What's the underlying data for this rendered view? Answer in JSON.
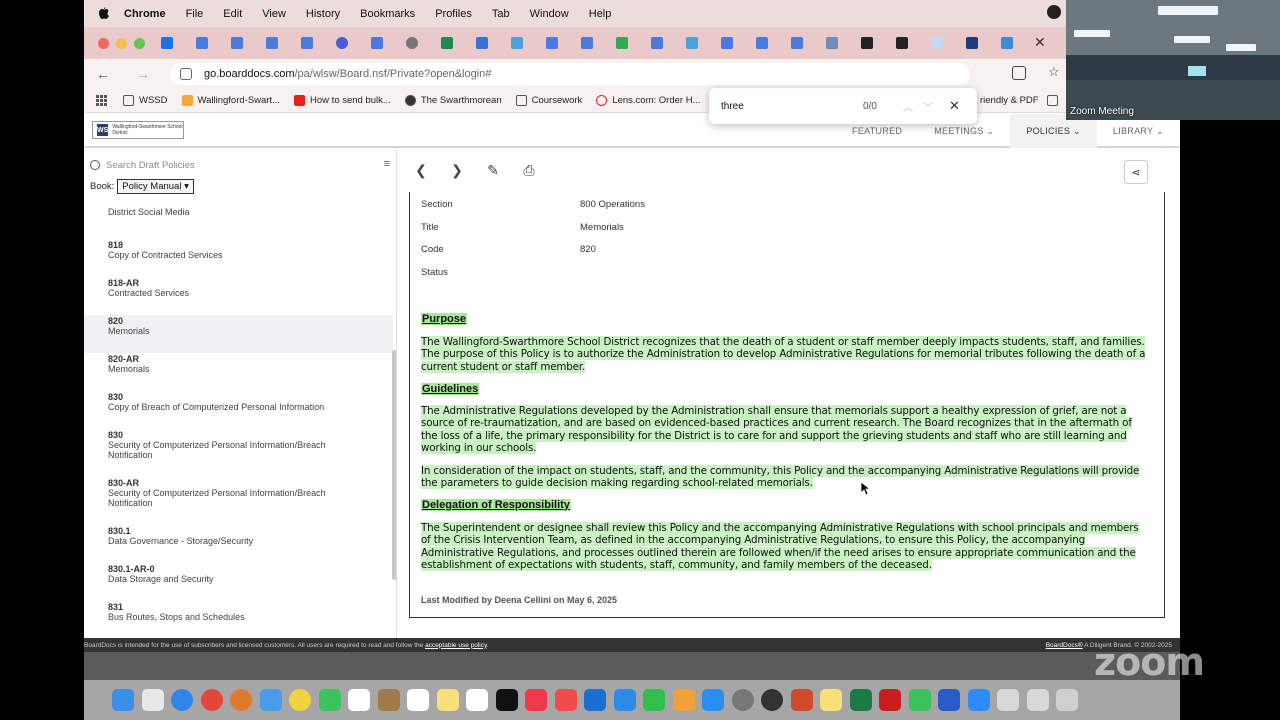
{
  "menubar": {
    "app": "Chrome",
    "items": [
      "File",
      "Edit",
      "View",
      "History",
      "Bookmarks",
      "Profiles",
      "Tab",
      "Window",
      "Help"
    ]
  },
  "address": {
    "host": "go.boarddocs.com",
    "path": "/pa/wlsw/Board.nsf/Private?open&login#"
  },
  "bookmarks": [
    "WSSD",
    "Wallingford-Swart...",
    "How to send bulk...",
    "The Swarthmorean",
    "Coursework",
    "Lens.com: Order H...",
    "riendly & PDF"
  ],
  "findbar": {
    "query": "three",
    "count": "0/0"
  },
  "boarddocs": {
    "logo_text": "Wallingford-Swarthmore School District",
    "nav": [
      "FEATURED",
      "MEETINGS",
      "POLICIES",
      "LIBRARY"
    ]
  },
  "leftpanel": {
    "search_placeholder": "Search Draft Policies",
    "book_label": "Book:",
    "book_value": "Policy Manual",
    "policies": [
      {
        "code": "",
        "title": "District Social Media"
      },
      {
        "code": "818",
        "title": "Copy of Contracted Services"
      },
      {
        "code": "818-AR",
        "title": "Contracted Services"
      },
      {
        "code": "820",
        "title": "Memorials"
      },
      {
        "code": "820-AR",
        "title": "Memorials"
      },
      {
        "code": "830",
        "title": "Copy of Breach of Computerized Personal Information"
      },
      {
        "code": "830",
        "title": "Security of Computerized Personal Information/Breach Notification"
      },
      {
        "code": "830-AR",
        "title": "Security of Computerized Personal Information/Breach Notification"
      },
      {
        "code": "830.1",
        "title": "Data Governance - Storage/Security"
      },
      {
        "code": "830.1-AR-0",
        "title": "Data Storage and Security"
      },
      {
        "code": "831",
        "title": "Bus Routes, Stops and Schedules"
      }
    ]
  },
  "doc": {
    "meta": [
      {
        "label": "Section",
        "value": "800 Operations"
      },
      {
        "label": "Title",
        "value": "Memorials"
      },
      {
        "label": "Code",
        "value": "820"
      },
      {
        "label": "Status",
        "value": ""
      }
    ],
    "purpose_head": "Purpose",
    "purpose_text": "The Wallingford-Swarthmore School District recognizes that the death of a student or staff member deeply impacts students, staff, and families.  The purpose of this Policy is to authorize the Administration to develop Administrative Regulations for memorial tributes following the death of a current student or staff member.",
    "guidelines_head": "Guidelines",
    "guidelines_text_1": "The Administrative Regulations developed by the Administration shall ensure that memorials support a healthy expression of grief, are not a source of re-traumatization, and are based on evidenced-based practices and current research.  The Board recognizes that in the aftermath of the loss of a life, the primary responsibility for the District is to care for and support the grieving students and staff who are still learning and working in our schools.",
    "guidelines_text_2": "In consideration of the impact on students, staff, and the community, this Policy and the accompanying Administrative Regulations will provide the parameters to guide decision making regarding school-related memorials.",
    "delegation_head": "Delegation of Responsibility",
    "delegation_text": "The Superintendent or designee shall review this Policy and the accompanying Administrative Regulations with school principals and members of the Crisis Intervention Team, as defined in the accompanying Administrative Regulations, to ensure this Policy, the accompanying Administrative Regulations, and processes outlined therein are followed when/if the need arises to ensure appropriate communication and the establishment of expectations with students, staff, community, and family members of the deceased.",
    "last_modified": "Last Modified by Deena Cellini on May 6, 2025"
  },
  "footer": {
    "left_text": "BoardDocs is intended for the use of subscribers and licensed customers. All users are required to read and follow the ",
    "left_link": "acceptable use policy",
    "left_end": ".",
    "right_link": "BoardDocs®",
    "right_text": " A Diligent Brand. © 2002-2025"
  },
  "zoom": {
    "label": "Zoom Meeting",
    "watermark": "zoom"
  },
  "colors": {
    "highlight": "#c9f2c2",
    "heading_highlight": "#a8e79c",
    "tabstrip": "#e9c9c9"
  }
}
